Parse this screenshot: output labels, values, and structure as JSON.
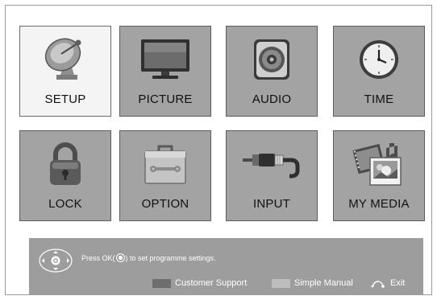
{
  "menu": {
    "tiles": [
      {
        "label": "SETUP",
        "icon": "satellite-dish-icon",
        "selected": true
      },
      {
        "label": "PICTURE",
        "icon": "tv-monitor-icon",
        "selected": false
      },
      {
        "label": "AUDIO",
        "icon": "speaker-icon",
        "selected": false
      },
      {
        "label": "TIME",
        "icon": "clock-icon",
        "selected": false
      },
      {
        "label": "LOCK",
        "icon": "padlock-icon",
        "selected": false
      },
      {
        "label": "OPTION",
        "icon": "toolbox-icon",
        "selected": false
      },
      {
        "label": "INPUT",
        "icon": "av-cable-icon",
        "selected": false
      },
      {
        "label": "MY MEDIA",
        "icon": "media-files-icon",
        "selected": false
      }
    ]
  },
  "help_bar": {
    "instruction_before": "Press OK(",
    "instruction_after": ") to set programme settings.",
    "customer_support": "Customer Support",
    "simple_manual": "Simple Manual",
    "exit": "Exit",
    "colors": {
      "customer_support_swatch": "#6e6e6e",
      "simple_manual_swatch": "#bdbdbd"
    }
  }
}
